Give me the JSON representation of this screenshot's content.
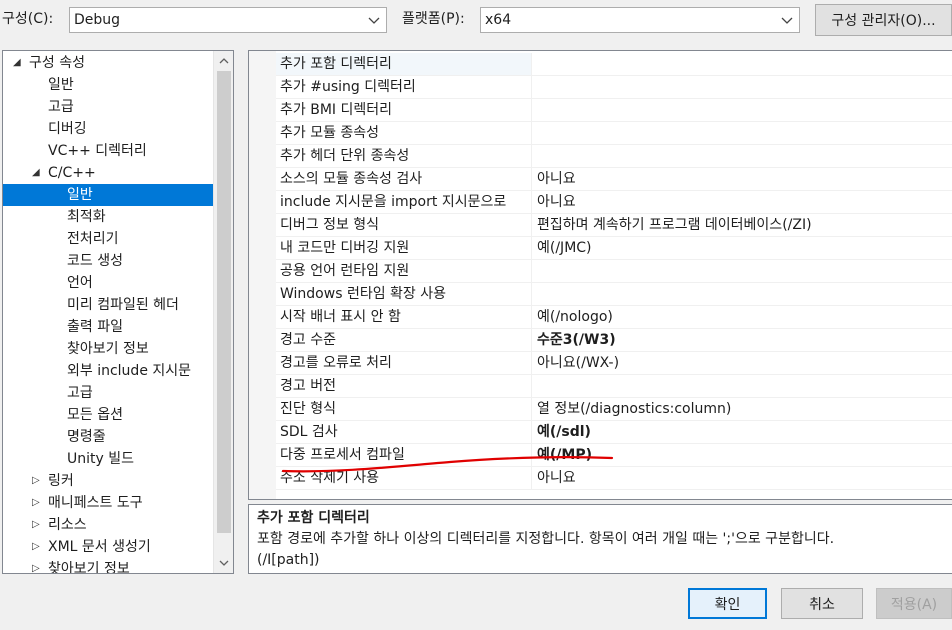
{
  "header": {
    "config_label": "구성(C):",
    "config_value": "Debug",
    "platform_label": "플랫폼(P):",
    "platform_value": "x64",
    "config_manager": "구성 관리자(O)..."
  },
  "tree": {
    "items": [
      {
        "label": "구성 속성"
      },
      {
        "label": "일반"
      },
      {
        "label": "고급"
      },
      {
        "label": "디버깅"
      },
      {
        "label": "VC++ 디렉터리"
      },
      {
        "label": "C/C++"
      },
      {
        "label": "일반"
      },
      {
        "label": "최적화"
      },
      {
        "label": "전처리기"
      },
      {
        "label": "코드 생성"
      },
      {
        "label": "언어"
      },
      {
        "label": "미리 컴파일된 헤더"
      },
      {
        "label": "출력 파일"
      },
      {
        "label": "찾아보기 정보"
      },
      {
        "label": "외부 include 지시문"
      },
      {
        "label": "고급"
      },
      {
        "label": "모든 옵션"
      },
      {
        "label": "명령줄"
      },
      {
        "label": "Unity 빌드"
      },
      {
        "label": "링커"
      },
      {
        "label": "매니페스트 도구"
      },
      {
        "label": "리소스"
      },
      {
        "label": "XML 문서 생성기"
      },
      {
        "label": "찾아보기 정보"
      }
    ]
  },
  "grid": {
    "rows": [
      {
        "name": "추가 포함 디렉터리",
        "value": ""
      },
      {
        "name": "추가 #using 디렉터리",
        "value": ""
      },
      {
        "name": "추가 BMI 디렉터리",
        "value": ""
      },
      {
        "name": "추가 모듈 종속성",
        "value": ""
      },
      {
        "name": "추가 헤더 단위 종속성",
        "value": ""
      },
      {
        "name": "소스의 모듈 종속성 검사",
        "value": "아니요"
      },
      {
        "name": "include 지시문을 import 지시문으로",
        "value": "아니요"
      },
      {
        "name": "디버그 정보 형식",
        "value": "편집하며 계속하기 프로그램 데이터베이스(/ZI)"
      },
      {
        "name": "내 코드만 디버깅 지원",
        "value": "예(/JMC)"
      },
      {
        "name": "공용 언어 런타임 지원",
        "value": ""
      },
      {
        "name": "Windows 런타임 확장 사용",
        "value": ""
      },
      {
        "name": "시작 배너 표시 안 함",
        "value": "예(/nologo)"
      },
      {
        "name": "경고 수준",
        "value": "수준3(/W3)"
      },
      {
        "name": "경고를 오류로 처리",
        "value": "아니요(/WX-)"
      },
      {
        "name": "경고 버전",
        "value": ""
      },
      {
        "name": "진단 형식",
        "value": "열 정보(/diagnostics:column)"
      },
      {
        "name": "SDL 검사",
        "value": "예(/sdl)"
      },
      {
        "name": "다중 프로세서 컴파일",
        "value": "예(/MP)"
      },
      {
        "name": "주소 삭제기 사용",
        "value": "아니요"
      }
    ]
  },
  "description": {
    "title": "추가 포함 디렉터리",
    "text": "포함 경로에 추가할 하나 이상의 디렉터리를 지정합니다. 항목이 여러 개일 때는 ';'으로 구분합니다.",
    "switch": "(/I[path])"
  },
  "buttons": {
    "ok": "확인",
    "cancel": "취소",
    "apply": "적용(A)"
  },
  "colors": {
    "selection": "#0078d7",
    "annotation": "#e00000"
  }
}
